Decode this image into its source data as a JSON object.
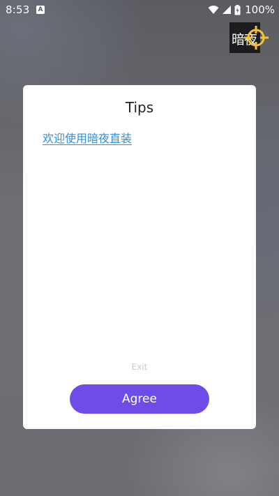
{
  "status_bar": {
    "time": "8:53",
    "notification_icon_letter": "A",
    "battery_percent": "100%",
    "icons": [
      "notification-a-icon",
      "wifi-icon",
      "cellular-signal-icon",
      "battery-icon"
    ]
  },
  "app_logo": {
    "text": "暗夜",
    "icon": "crosshair-icon",
    "accent_color": "#f5c12e"
  },
  "dialog": {
    "title": "Tips",
    "link_text": "欢迎使用暗夜直装",
    "exit_label": "Exit",
    "agree_label": "Agree"
  },
  "colors": {
    "accent": "#6d4ce8",
    "link": "#2f8fd8",
    "overlay_background": "#6e6e70"
  }
}
